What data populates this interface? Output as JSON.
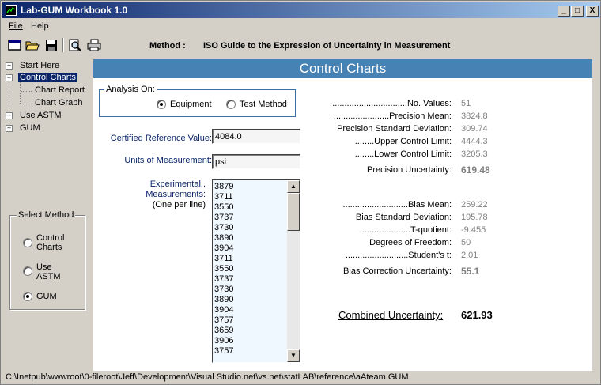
{
  "window": {
    "title": "Lab-GUM Workbook 1.0",
    "minimize": "_",
    "maximize": "□",
    "close": "X"
  },
  "menu": {
    "file": "File",
    "help": "Help"
  },
  "toolbar": {
    "method_label": "Method :",
    "method_value": "ISO Guide to the Expression of Uncertainty in Measurement",
    "icons": [
      "new-document-icon",
      "open-folder-icon",
      "save-disk-icon",
      "print-preview-icon",
      "print-icon"
    ]
  },
  "tree": {
    "items": [
      {
        "label": "Start Here",
        "toggle": "+"
      },
      {
        "label": "Control Charts",
        "toggle": "−"
      },
      {
        "label": "Chart Report"
      },
      {
        "label": "Chart Graph"
      },
      {
        "label": "Use ASTM",
        "toggle": "+"
      },
      {
        "label": "GUM",
        "toggle": "+"
      }
    ]
  },
  "select_method": {
    "legend": "Select Method",
    "options": [
      {
        "label_1": "Control",
        "label_2": "Charts",
        "checked": false
      },
      {
        "label_1": "Use",
        "label_2": "ASTM",
        "checked": false
      },
      {
        "label_1": "GUM",
        "label_2": "",
        "checked": true
      }
    ]
  },
  "panel": {
    "title": "Control Charts",
    "analysis": {
      "legend": "Analysis On:",
      "option_equipment": "Equipment",
      "option_test_method": "Test Method",
      "selected": "Equipment"
    },
    "certified_label": "Certified Reference Value:",
    "certified_value": "4084.0",
    "units_label": "Units of Measurement:",
    "units_value": "psi",
    "measurements_label_1": "Experimental..",
    "measurements_label_2": "Measurements:",
    "measurements_label_3": "(One per line)",
    "measurements": [
      "3879",
      "3711",
      "3550",
      "3737",
      "3730",
      "3890",
      "3904",
      "3711",
      "3550",
      "3737",
      "3730",
      "3890",
      "3904",
      "3757",
      "3659",
      "3906",
      "3757"
    ]
  },
  "stats": {
    "precision": [
      {
        "label": "...............................No. Values:",
        "value": "51"
      },
      {
        "label": ".......................Precision Mean:",
        "value": "3824.8"
      },
      {
        "label": "Precision Standard Deviation:",
        "value": "309.74"
      },
      {
        "label": "........Upper Control Limit:",
        "value": "4444.3"
      },
      {
        "label": "........Lower Control Limit:",
        "value": "3205.3"
      },
      {
        "label": "Precision Uncertainty:",
        "value": "619.48"
      }
    ],
    "bias": [
      {
        "label": "...........................Bias Mean:",
        "value": "259.22"
      },
      {
        "label": "Bias Standard Deviation:",
        "value": "195.78"
      },
      {
        "label": ".....................T-quotient:",
        "value": "-9.455"
      },
      {
        "label": "Degrees of Freedom:",
        "value": "50"
      },
      {
        "label": "..........................Student's t:",
        "value": "2.01"
      },
      {
        "label": "Bias Correction Uncertainty:",
        "value": "55.1"
      }
    ],
    "combined_label": "Combined Uncertainty:",
    "combined_value": "621.93"
  },
  "status": {
    "path": "C:\\Inetpub\\wwwroot\\0-fileroot\\Jeff\\Development\\Visual Studio.net\\vs.net\\statLAB\\reference\\aAteam.GUM"
  },
  "colors": {
    "panel_header": "#4682b4",
    "title_bar": "#0a246a",
    "list_background": "#f0f8ff"
  }
}
